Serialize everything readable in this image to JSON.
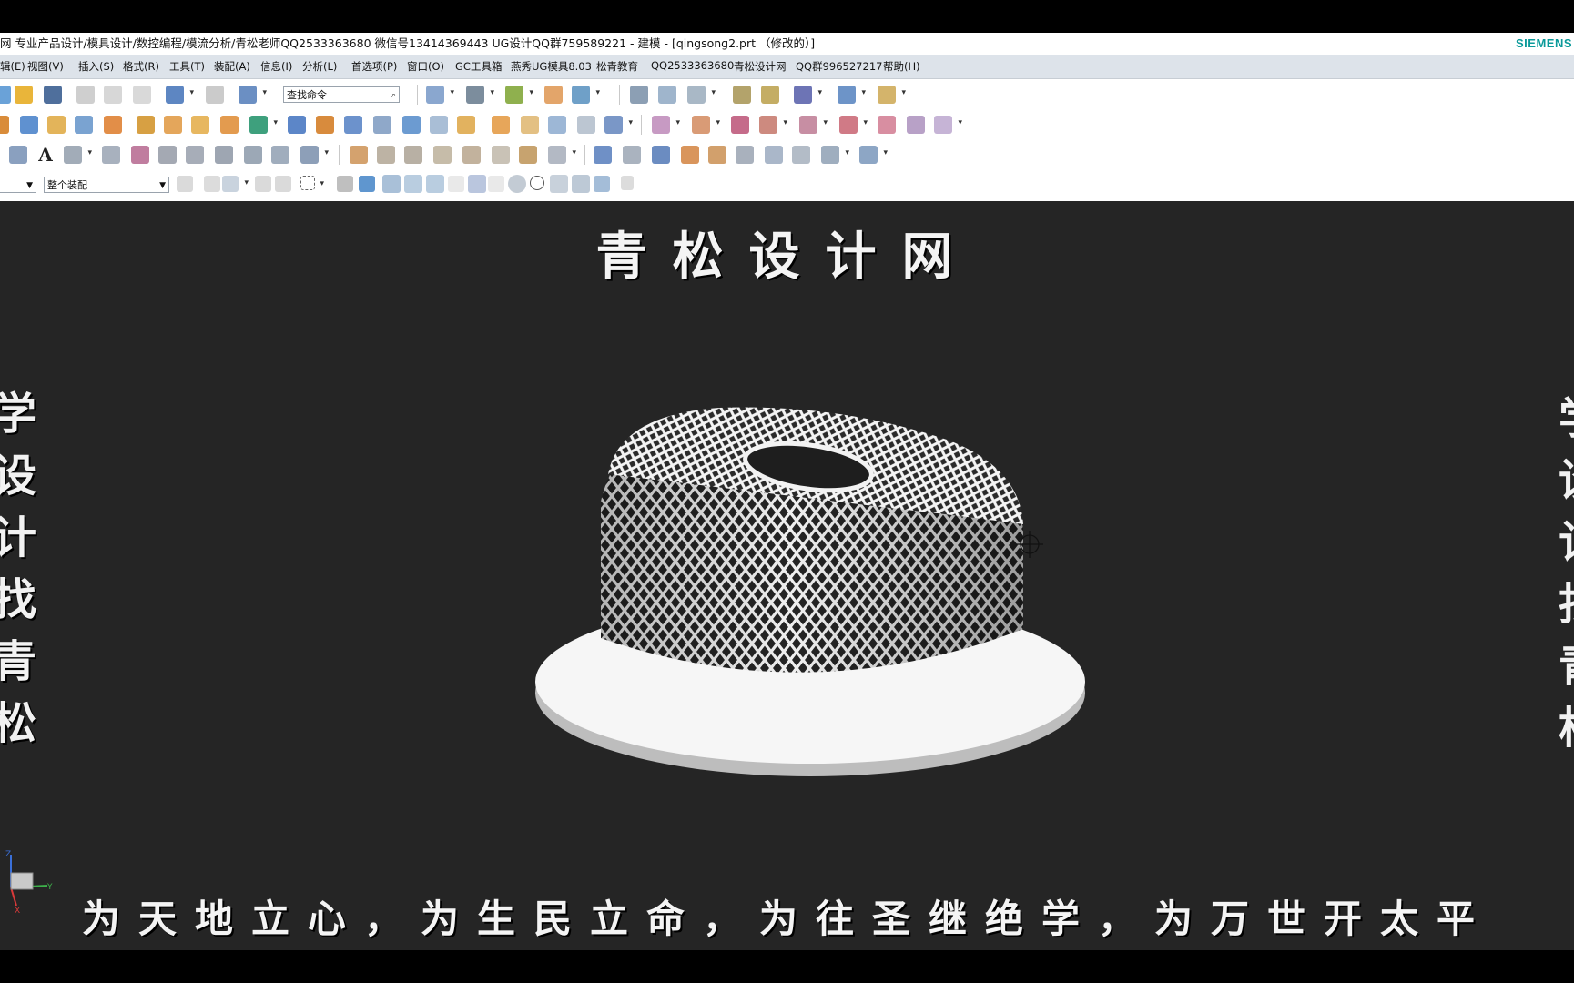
{
  "window": {
    "title": "网 专业产品设计/模具设计/数控编程/模流分析/青松老师QQ2533363680 微信号13414369443 UG设计QQ群759589221 - 建模 - [qingsong2.prt （修改的）]",
    "brand": "SIEMENS"
  },
  "menu": {
    "items": [
      "辑(E)",
      "视图(V)",
      "插入(S)",
      "格式(R)",
      "工具(T)",
      "装配(A)",
      "信息(I)",
      "分析(L)",
      "首选项(P)",
      "窗口(O)",
      "GC工具箱",
      "燕秀UG模具8.03",
      "松青教育",
      "QQ2533363680",
      "青松设计网",
      "QQ群996527217",
      "帮助(H)"
    ]
  },
  "toolbar": {
    "search_placeholder": "查找命令",
    "assembly_scope": "整个装配"
  },
  "watermark": {
    "title": "青松设计网",
    "left_vertical": [
      "学",
      "设",
      "计",
      "找",
      "青",
      "松"
    ],
    "right_vertical": [
      "学",
      "设",
      "计",
      "找",
      "青",
      "松"
    ],
    "bottom_motto": "为天地立心，为生民立命，为往圣继绝学，为万世开太平"
  },
  "triad": {
    "z": "Z",
    "y": "Y",
    "x": "X"
  },
  "colors": {
    "viewport_bg": "#252525",
    "menubar_bg": "#dde3ea",
    "brand": "#0b9a9a",
    "model": "#f2f2f2"
  }
}
